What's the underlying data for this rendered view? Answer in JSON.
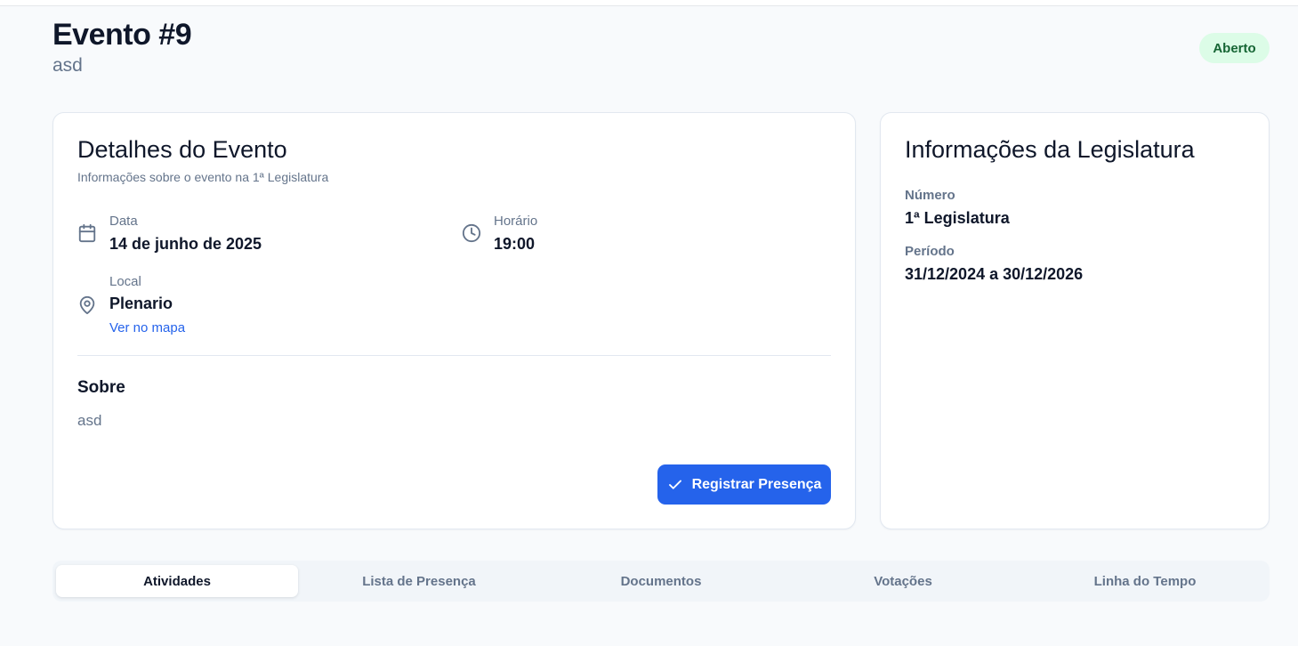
{
  "header": {
    "title": "Evento #9",
    "subtitle": "asd",
    "status_badge": "Aberto"
  },
  "details_card": {
    "title": "Detalhes do Evento",
    "description": "Informações sobre o evento na 1ª Legislatura",
    "date": {
      "label": "Data",
      "value": "14 de junho de 2025",
      "icon": "calendar-icon"
    },
    "time": {
      "label": "Horário",
      "value": "19:00",
      "icon": "clock-icon"
    },
    "location": {
      "label": "Local",
      "value": "Plenario",
      "link": "Ver no mapa",
      "icon": "map-pin-icon"
    },
    "about": {
      "title": "Sobre",
      "text": "asd"
    },
    "register_button": {
      "label": "Registrar Presença",
      "icon": "check-icon"
    }
  },
  "legislature_card": {
    "title": "Informações da Legislatura",
    "number": {
      "label": "Número",
      "value": "1ª Legislatura"
    },
    "period": {
      "label": "Período",
      "value": "31/12/2024 a 30/12/2026"
    }
  },
  "tabs": [
    {
      "label": "Atividades",
      "active": true
    },
    {
      "label": "Lista de Presença",
      "active": false
    },
    {
      "label": "Documentos",
      "active": false
    },
    {
      "label": "Votações",
      "active": false
    },
    {
      "label": "Linha do Tempo",
      "active": false
    }
  ],
  "colors": {
    "primary": "#2563eb",
    "badge_bg": "#dcfce7",
    "badge_text": "#166534",
    "muted_text": "#64748b",
    "background": "#f8fafc"
  }
}
